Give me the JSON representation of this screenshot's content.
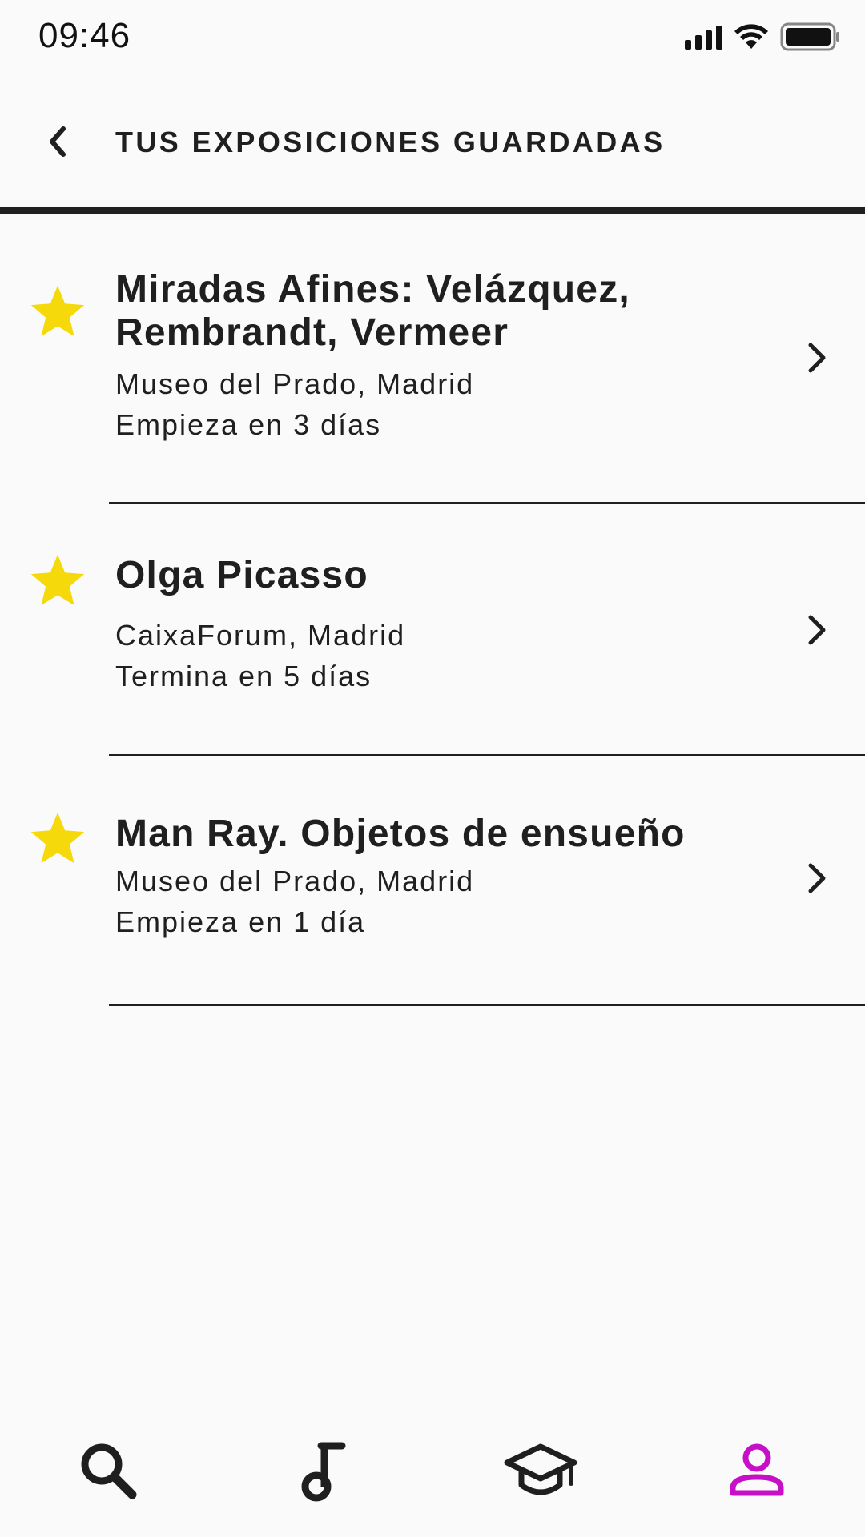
{
  "status_bar": {
    "time": "09:46"
  },
  "header": {
    "title": "TUS EXPOSICIONES GUARDADAS"
  },
  "items": [
    {
      "title": "Miradas Afines: Velázquez, Rembrandt, Vermeer",
      "venue": "Museo del Prado, Madrid",
      "status": "Empieza en 3 días"
    },
    {
      "title": "Olga Picasso",
      "venue": "CaixaForum, Madrid",
      "status": "Termina en 5 días"
    },
    {
      "title": "Man Ray. Objetos de ensueño",
      "venue": "Museo del Prado, Madrid",
      "status": "Empieza en 1 día"
    }
  ],
  "bottom_nav": {
    "items": [
      {
        "icon": "search-icon",
        "active": false
      },
      {
        "icon": "music-note-icon",
        "active": false
      },
      {
        "icon": "graduation-cap-icon",
        "active": false
      },
      {
        "icon": "user-icon",
        "active": true
      }
    ]
  },
  "colors": {
    "star": "#f5d90a",
    "active_nav": "#c80fc8",
    "text": "#1f1f1f",
    "background": "#fafafa"
  }
}
